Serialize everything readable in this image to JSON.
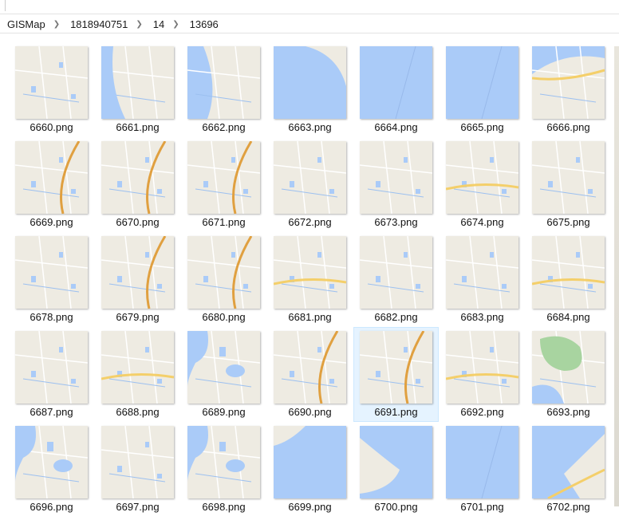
{
  "breadcrumb": [
    "GISMap",
    "1818940751",
    "14",
    "13696"
  ],
  "selected": "6691.png",
  "colors": {
    "land": "#eeebe2",
    "water": "#aacbf8",
    "road": "#f4cf6a",
    "mainroad": "#e0a040",
    "park": "#a8d4a0",
    "selection": "#e5f3ff"
  },
  "rows": [
    [
      {
        "name": "6660.png",
        "t": "land"
      },
      {
        "name": "6661.png",
        "t": "coastL"
      },
      {
        "name": "6662.png",
        "t": "coastL2"
      },
      {
        "name": "6663.png",
        "t": "water2"
      },
      {
        "name": "6664.png",
        "t": "water"
      },
      {
        "name": "6665.png",
        "t": "water"
      },
      {
        "name": "6666.png",
        "t": "coastTop"
      }
    ],
    [
      {
        "name": "6669.png",
        "t": "road"
      },
      {
        "name": "6670.png",
        "t": "road"
      },
      {
        "name": "6671.png",
        "t": "road"
      },
      {
        "name": "6672.png",
        "t": "land"
      },
      {
        "name": "6673.png",
        "t": "land"
      },
      {
        "name": "6674.png",
        "t": "road2"
      },
      {
        "name": "6675.png",
        "t": "land"
      }
    ],
    [
      {
        "name": "6678.png",
        "t": "land"
      },
      {
        "name": "6679.png",
        "t": "road"
      },
      {
        "name": "6680.png",
        "t": "road"
      },
      {
        "name": "6681.png",
        "t": "road2"
      },
      {
        "name": "6682.png",
        "t": "land"
      },
      {
        "name": "6683.png",
        "t": "land"
      },
      {
        "name": "6684.png",
        "t": "road2"
      }
    ],
    [
      {
        "name": "6687.png",
        "t": "land"
      },
      {
        "name": "6688.png",
        "t": "road2"
      },
      {
        "name": "6689.png",
        "t": "lakes"
      },
      {
        "name": "6690.png",
        "t": "road"
      },
      {
        "name": "6691.png",
        "t": "road"
      },
      {
        "name": "6692.png",
        "t": "road2"
      },
      {
        "name": "6693.png",
        "t": "park"
      }
    ],
    [
      {
        "name": "6696.png",
        "t": "lakes"
      },
      {
        "name": "6697.png",
        "t": "land"
      },
      {
        "name": "6698.png",
        "t": "lakes"
      },
      {
        "name": "6699.png",
        "t": "coastL3"
      },
      {
        "name": "6700.png",
        "t": "water3"
      },
      {
        "name": "6701.png",
        "t": "water"
      },
      {
        "name": "6702.png",
        "t": "water4"
      }
    ]
  ]
}
